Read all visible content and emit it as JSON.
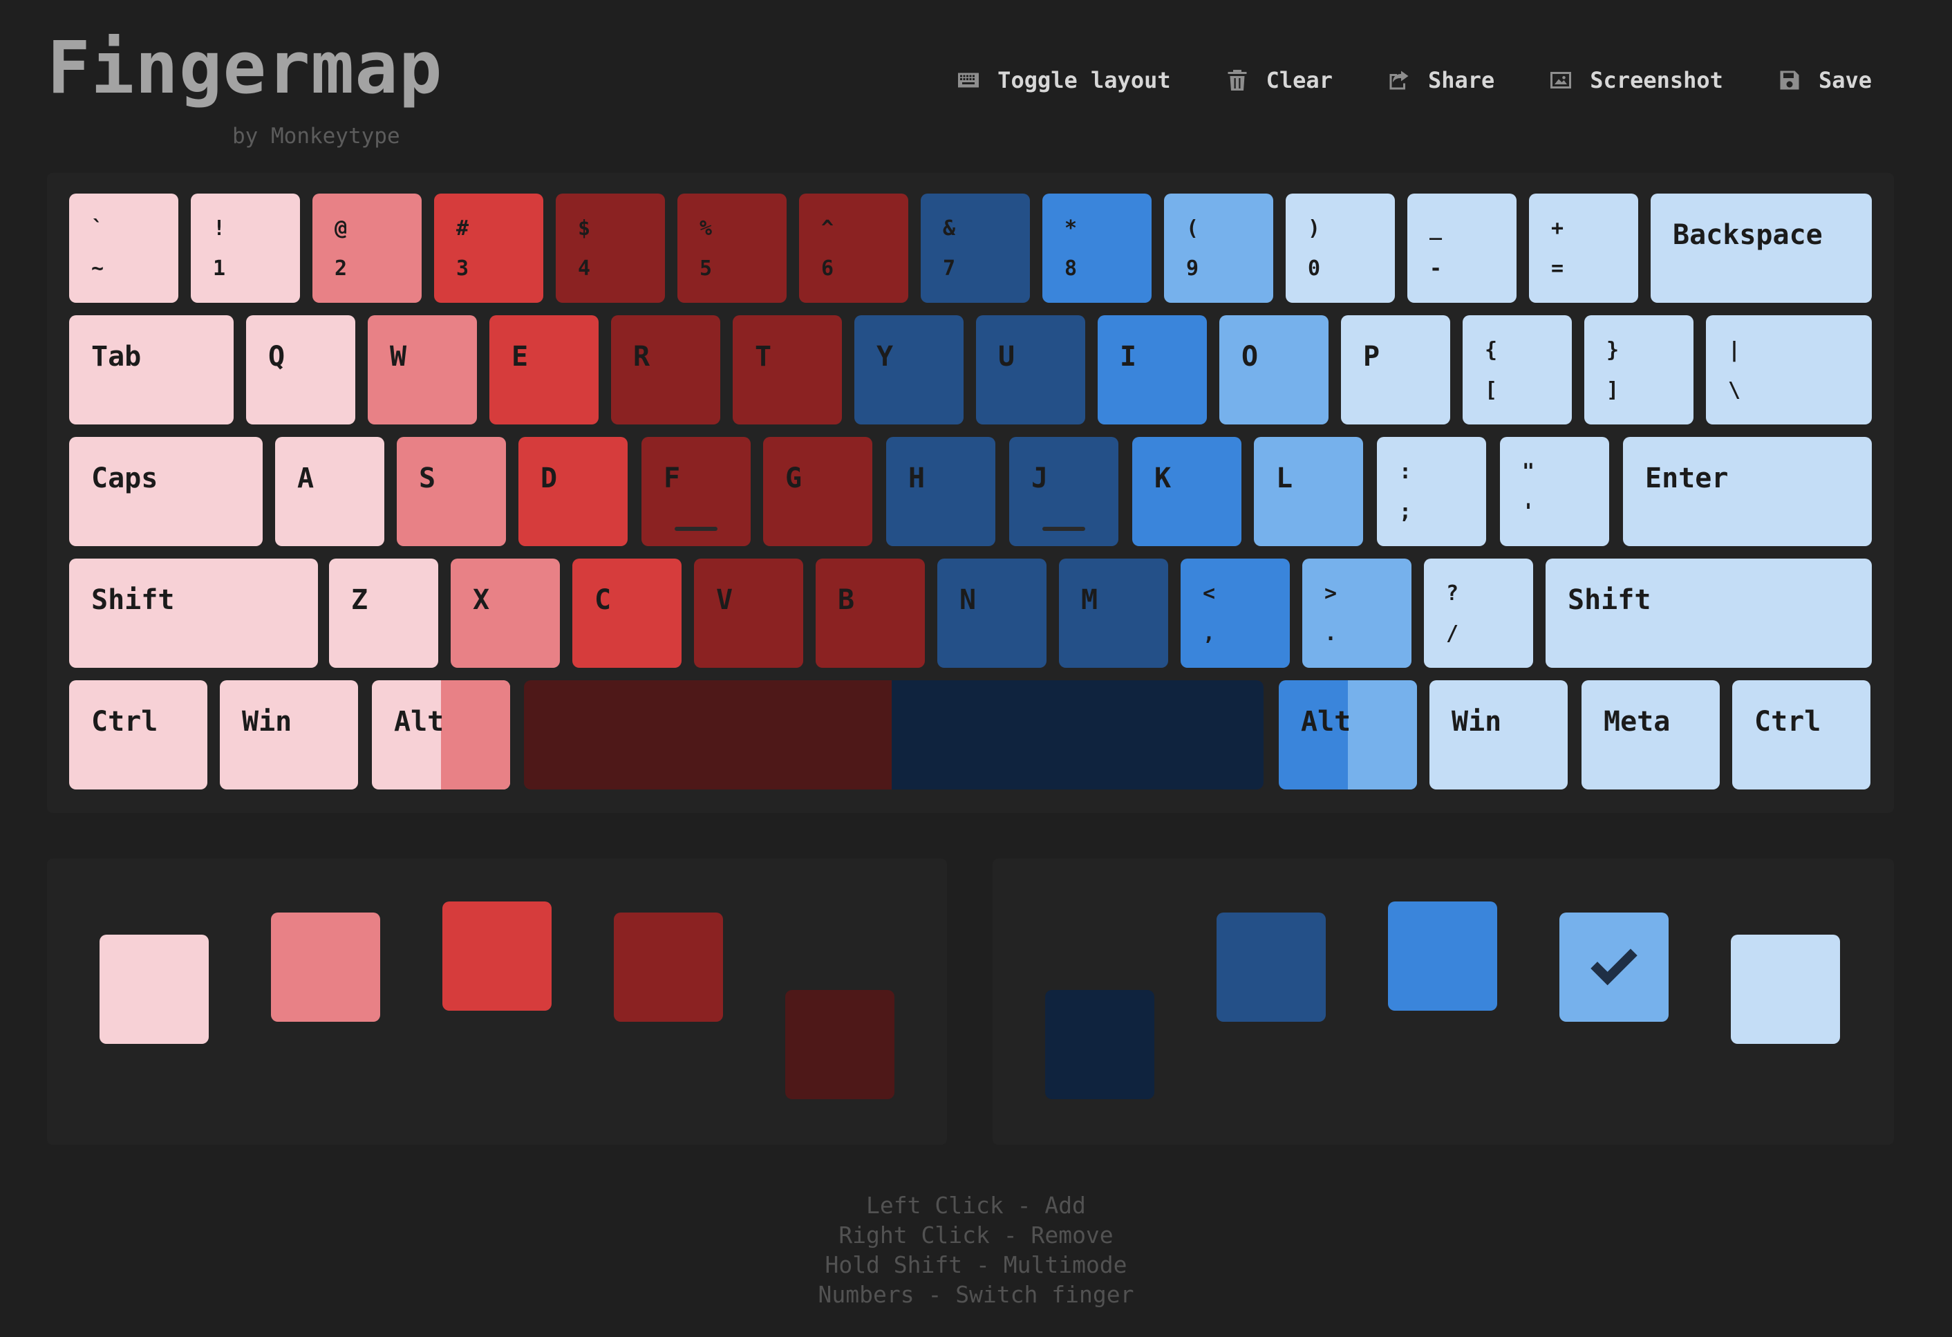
{
  "brand": {
    "title": "Fingermap",
    "subtitle": "by Monkeytype"
  },
  "toolbar": [
    {
      "label": "Toggle layout",
      "icon": "keyboard-icon"
    },
    {
      "label": "Clear",
      "icon": "trash-icon"
    },
    {
      "label": "Share",
      "icon": "share-icon"
    },
    {
      "label": "Screenshot",
      "icon": "image-icon"
    },
    {
      "label": "Save",
      "icon": "save-icon"
    }
  ],
  "colors": {
    "L1": "#f7d1d6",
    "L2": "#e88186",
    "L3": "#d63c3c",
    "L4": "#8b2222",
    "L5": "#4e1818",
    "R1": "#0f233e",
    "R2": "#245088",
    "R3": "#3a85db",
    "R4": "#76b1ec",
    "R5": "#c4ddf6"
  },
  "keyboard": {
    "rows": [
      [
        {
          "name": "key-backtick",
          "top": "`",
          "bot": "~",
          "finger": "L1"
        },
        {
          "name": "key-1",
          "top": "!",
          "bot": "1",
          "finger": "L1"
        },
        {
          "name": "key-2",
          "top": "@",
          "bot": "2",
          "finger": "L2"
        },
        {
          "name": "key-3",
          "top": "#",
          "bot": "3",
          "finger": "L3"
        },
        {
          "name": "key-4",
          "top": "$",
          "bot": "4",
          "finger": "L4"
        },
        {
          "name": "key-5",
          "top": "%",
          "bot": "5",
          "finger": "L4"
        },
        {
          "name": "key-6",
          "top": "^",
          "bot": "6",
          "finger": "L4"
        },
        {
          "name": "key-7",
          "top": "&",
          "bot": "7",
          "finger": "R2"
        },
        {
          "name": "key-8",
          "top": "*",
          "bot": "8",
          "finger": "R3"
        },
        {
          "name": "key-9",
          "top": "(",
          "bot": "9",
          "finger": "R4"
        },
        {
          "name": "key-0",
          "top": ")",
          "bot": "0",
          "finger": "R5"
        },
        {
          "name": "key-minus",
          "top": "_",
          "bot": "-",
          "finger": "R5"
        },
        {
          "name": "key-equals",
          "top": "+",
          "bot": "=",
          "finger": "R5"
        },
        {
          "name": "key-backspace",
          "label": "Backspace",
          "finger": "R5"
        }
      ],
      [
        {
          "name": "key-tab",
          "label": "Tab",
          "finger": "L1"
        },
        {
          "name": "key-q",
          "label": "Q",
          "finger": "L1"
        },
        {
          "name": "key-w",
          "label": "W",
          "finger": "L2"
        },
        {
          "name": "key-e",
          "label": "E",
          "finger": "L3"
        },
        {
          "name": "key-r",
          "label": "R",
          "finger": "L4"
        },
        {
          "name": "key-t",
          "label": "T",
          "finger": "L4"
        },
        {
          "name": "key-y",
          "label": "Y",
          "finger": "R2"
        },
        {
          "name": "key-u",
          "label": "U",
          "finger": "R2"
        },
        {
          "name": "key-i",
          "label": "I",
          "finger": "R3"
        },
        {
          "name": "key-o",
          "label": "O",
          "finger": "R4"
        },
        {
          "name": "key-p",
          "label": "P",
          "finger": "R5"
        },
        {
          "name": "key-lbracket",
          "top": "{",
          "bot": "[",
          "finger": "R5"
        },
        {
          "name": "key-rbracket",
          "top": "}",
          "bot": "]",
          "finger": "R5"
        },
        {
          "name": "key-backslash",
          "top": "|",
          "bot": "\\",
          "finger": "R5"
        }
      ],
      [
        {
          "name": "key-caps",
          "label": "Caps",
          "finger": "L1"
        },
        {
          "name": "key-a",
          "label": "A",
          "finger": "L1"
        },
        {
          "name": "key-s",
          "label": "S",
          "finger": "L2"
        },
        {
          "name": "key-d",
          "label": "D",
          "finger": "L3"
        },
        {
          "name": "key-f",
          "label": "F",
          "finger": "L4",
          "bump": true
        },
        {
          "name": "key-g",
          "label": "G",
          "finger": "L4"
        },
        {
          "name": "key-h",
          "label": "H",
          "finger": "R2"
        },
        {
          "name": "key-j",
          "label": "J",
          "finger": "R2",
          "bump": true
        },
        {
          "name": "key-k",
          "label": "K",
          "finger": "R3"
        },
        {
          "name": "key-l",
          "label": "L",
          "finger": "R4"
        },
        {
          "name": "key-semicolon",
          "top": ":",
          "bot": ";",
          "finger": "R5"
        },
        {
          "name": "key-quote",
          "top": "\"",
          "bot": "'",
          "finger": "R5"
        },
        {
          "name": "key-enter",
          "label": "Enter",
          "finger": "R5"
        }
      ],
      [
        {
          "name": "key-lshift",
          "label": "Shift",
          "finger": "L1"
        },
        {
          "name": "key-z",
          "label": "Z",
          "finger": "L1"
        },
        {
          "name": "key-x",
          "label": "X",
          "finger": "L2"
        },
        {
          "name": "key-c",
          "label": "C",
          "finger": "L3"
        },
        {
          "name": "key-v",
          "label": "V",
          "finger": "L4"
        },
        {
          "name": "key-b",
          "label": "B",
          "finger": "L4"
        },
        {
          "name": "key-n",
          "label": "N",
          "finger": "R2"
        },
        {
          "name": "key-m",
          "label": "M",
          "finger": "R2"
        },
        {
          "name": "key-comma",
          "top": "<",
          "bot": ",",
          "finger": "R3"
        },
        {
          "name": "key-period",
          "top": ">",
          "bot": ".",
          "finger": "R4"
        },
        {
          "name": "key-slash",
          "top": "?",
          "bot": "/",
          "finger": "R5"
        },
        {
          "name": "key-rshift",
          "label": "Shift",
          "finger": "R5"
        }
      ],
      [
        {
          "name": "key-lctrl",
          "label": "Ctrl",
          "finger": "L1"
        },
        {
          "name": "key-lwin",
          "label": "Win",
          "finger": "L1"
        },
        {
          "name": "key-lalt",
          "label": "Alt",
          "finger": "L1",
          "finger2": "L2"
        },
        {
          "name": "key-space",
          "label": "",
          "finger": "L5",
          "finger2": "R1",
          "split": 0.497
        },
        {
          "name": "key-ralt",
          "label": "Alt",
          "finger": "R3",
          "finger2": "R4"
        },
        {
          "name": "key-rwin",
          "label": "Win",
          "finger": "R5"
        },
        {
          "name": "key-meta",
          "label": "Meta",
          "finger": "R5"
        },
        {
          "name": "key-rctrl",
          "label": "Ctrl",
          "finger": "R5"
        }
      ]
    ]
  },
  "fingers": {
    "left": [
      "L1",
      "L2",
      "L3",
      "L4",
      "L5"
    ],
    "right": [
      "R1",
      "R2",
      "R3",
      "R4",
      "R5"
    ],
    "selected": "R4"
  },
  "help": [
    "Left Click - Add",
    "Right Click - Remove",
    "Hold Shift - Multimode",
    "Numbers - Switch finger"
  ]
}
